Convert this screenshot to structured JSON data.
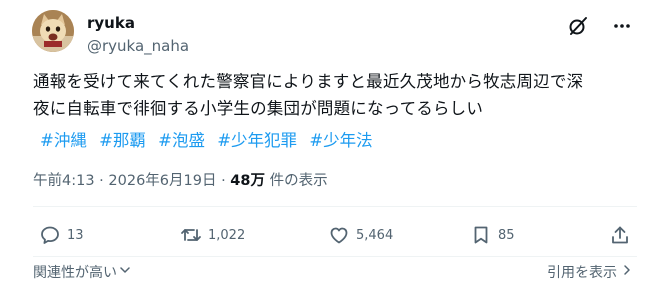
{
  "author": {
    "display_name": "ryuka",
    "handle": "@ryuka_naha",
    "avatar_icon": "cat-avatar"
  },
  "header_icons": [
    "grok-icon",
    "more-icon"
  ],
  "post": {
    "lines": [
      "通報を受けて来てくれた警察官によりますと最近久茂地から牧志周辺で深",
      "夜に自転車で徘徊する小学生の集団が問題になってるらしい"
    ],
    "hashtags": [
      "#沖縄",
      "#那覇",
      "#泡盛",
      "#少年犯罪",
      "#少年法"
    ]
  },
  "meta": {
    "time": "午前4:13",
    "separator": "·",
    "date": "2026年6月19日",
    "views_count": "48万",
    "views_label": "件の表示"
  },
  "actions": {
    "reply_count": "13",
    "repost_count": "1,022",
    "like_count": "5,464",
    "bookmark_count": "85"
  },
  "footer": {
    "related_label": "関連性が高い",
    "quote_label": "引用を表示"
  },
  "colors": {
    "text": "#0f1419",
    "secondary": "#536471",
    "link": "#1d9bf0",
    "divider": "#eff3f4"
  }
}
